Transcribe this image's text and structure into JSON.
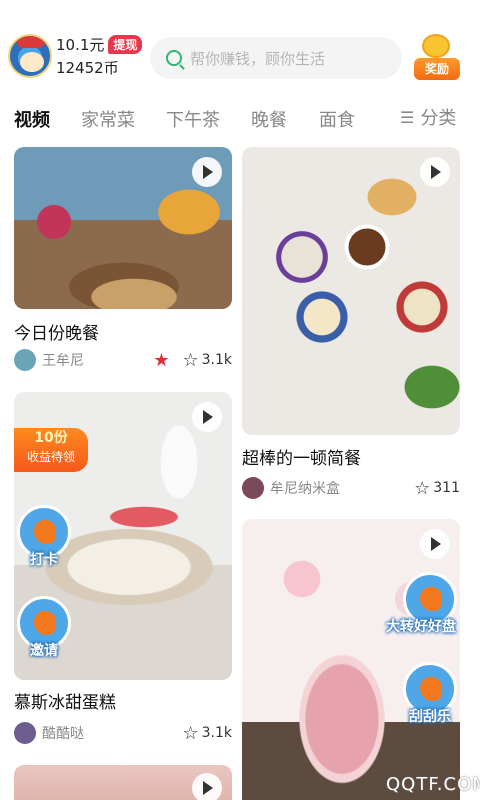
{
  "header": {
    "balance": "10.1元",
    "withdraw_label": "提现",
    "coins": "12452币",
    "search_placeholder": "帮你赚钱，顾你生活",
    "reward_label": "奖励"
  },
  "tabs": [
    "视频",
    "家常菜",
    "下午茶",
    "晚餐",
    "面食"
  ],
  "category_label": "分类",
  "cards": [
    {
      "title": "今日份晚餐",
      "author": "王牟尼",
      "likes": "3.1k"
    },
    {
      "title": "超棒的一顿简餐",
      "author": "牟尼纳米盒",
      "likes": "311"
    },
    {
      "title": "慕斯冰甜蛋糕",
      "author": "酷酷哒",
      "likes": "3.1k"
    }
  ],
  "overlays": {
    "badge_amount": "10份",
    "badge_sub": "收益待领",
    "checkin": "打卡",
    "invite": "邀请",
    "wheel": "大转好好盘",
    "scratch": "刮刮乐"
  },
  "watermark": "QQTF.COM",
  "colors": {
    "accent_red": "#e8374a",
    "search_icon": "#2bb673",
    "reward_orange": "#f26a12"
  }
}
